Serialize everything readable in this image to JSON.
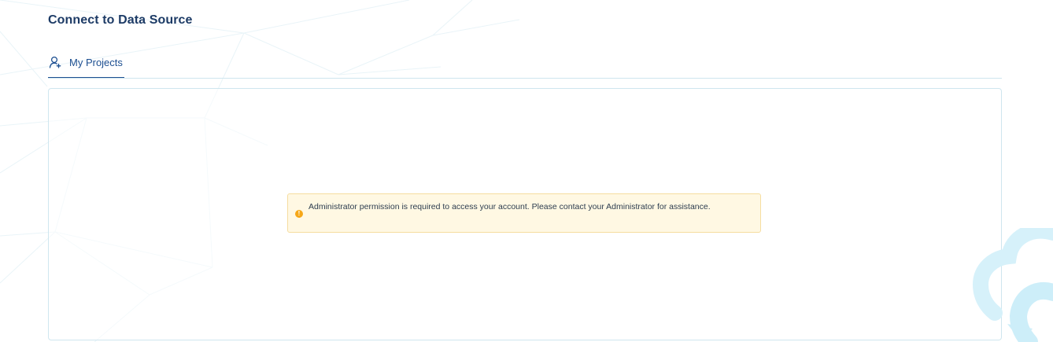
{
  "page": {
    "title": "Connect to Data Source"
  },
  "tabs": [
    {
      "label": "My Projects",
      "icon": "user-add-icon",
      "active": true
    }
  ],
  "alert": {
    "icon": "warning-circle-icon",
    "message": "Administrator permission is required to access your account. Please contact your Administrator for assistance."
  },
  "colors": {
    "title": "#1d3b66",
    "tab_active": "#1d4f91",
    "border": "#cfe6ef",
    "alert_bg": "#fff8e3",
    "alert_border": "#f6dda0",
    "alert_icon": "#f6a717",
    "logo": "#d6f1fa"
  }
}
